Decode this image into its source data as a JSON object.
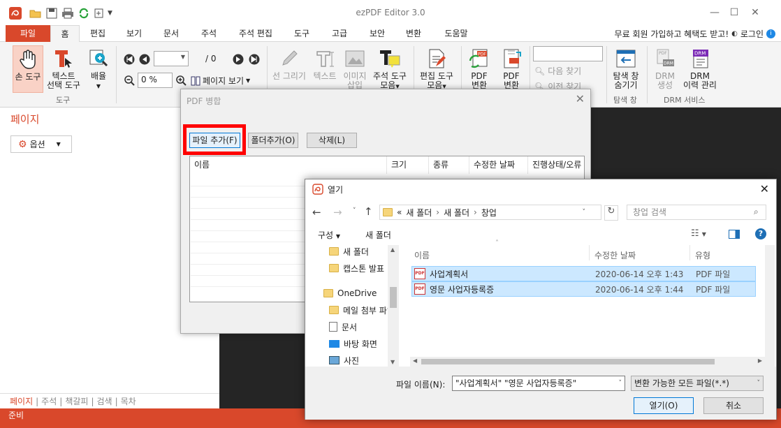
{
  "app": {
    "title": "ezPDF Editor 3.0",
    "accent": "#d9482b",
    "tabs": [
      "파일",
      "홈",
      "편집",
      "보기",
      "문서",
      "주석",
      "주석 편집",
      "도구",
      "고급",
      "보안",
      "변환",
      "도움말"
    ],
    "signup_text": "무료 회원 가입하고 혜택도 받고!",
    "login_text": "로그인",
    "ribbon": {
      "hand_tool": "손 도구",
      "text_select_tool_l1": "텍스트",
      "text_select_tool_l2": "선택 도구",
      "zoom_l1": "배율",
      "tools_group": "도구",
      "page_total": "/ 0",
      "zoom_value": "0 %",
      "page_view": "페이지 보기",
      "line_draw": "선 그리기",
      "text": "텍스트",
      "image_insert_l1": "이미지",
      "image_insert_l2": "삽입",
      "annot_tools_l1": "주석 도구",
      "annot_tools_l2": "모음",
      "edit_tools_l1": "편집 도구",
      "edit_tools_l2": "모음",
      "pdf_convert_1_l1": "PDF",
      "pdf_convert_1_l2": "변환",
      "pdf_convert_2_l1": "PDF",
      "pdf_convert_2_l2": "변환",
      "find_next": "다음 찾기",
      "find_prev": "이전 찾기",
      "nav_hide_l1": "탐색 창",
      "nav_hide_l2": "숨기기",
      "nav_group": "탐색 창",
      "drm_create_l1": "DRM",
      "drm_create_l2": "생성",
      "drm_history_l1": "DRM",
      "drm_history_l2": "이력 관리",
      "drm_group": "DRM 서비스"
    },
    "left_panel": {
      "title": "페이지",
      "options": "옵션",
      "bottom_tabs": [
        "페이지",
        "주석",
        "책갈피",
        "검색",
        "목차"
      ]
    },
    "status": "준비"
  },
  "merge_dialog": {
    "title": "PDF 병합",
    "add_file": "파일 추가(F)",
    "add_folder": "폴더추가(O)",
    "delete": "삭제(L)",
    "columns": [
      "이름",
      "크기",
      "종류",
      "수정한 날짜",
      "진행상태/오류"
    ]
  },
  "open_dialog": {
    "title": "열기",
    "breadcrumb": [
      "«",
      "새 폴더",
      "새 폴더",
      "창업"
    ],
    "search_placeholder": "창업 검색",
    "organize": "구성",
    "new_folder": "새 폴더",
    "nav_items": [
      "새 폴더",
      "캡스톤 발표",
      "OneDrive",
      "메일 첨부 파일",
      "문서",
      "바탕 화면",
      "사진"
    ],
    "columns": [
      "이름",
      "수정한 날짜",
      "유형"
    ],
    "files": [
      {
        "name": "사업계획서",
        "date": "2020-06-14 오후 1:43",
        "type": "PDF 파일"
      },
      {
        "name": "영문 사업자등록증",
        "date": "2020-06-14 오후 1:44",
        "type": "PDF 파일"
      }
    ],
    "filename_label": "파일 이름(N):",
    "filename_value": "\"사업계획서\" \"영문 사업자등록증\"",
    "filter_value": "변환 가능한 모든 파일(*.*)",
    "open_btn": "열기(O)",
    "cancel_btn": "취소"
  }
}
